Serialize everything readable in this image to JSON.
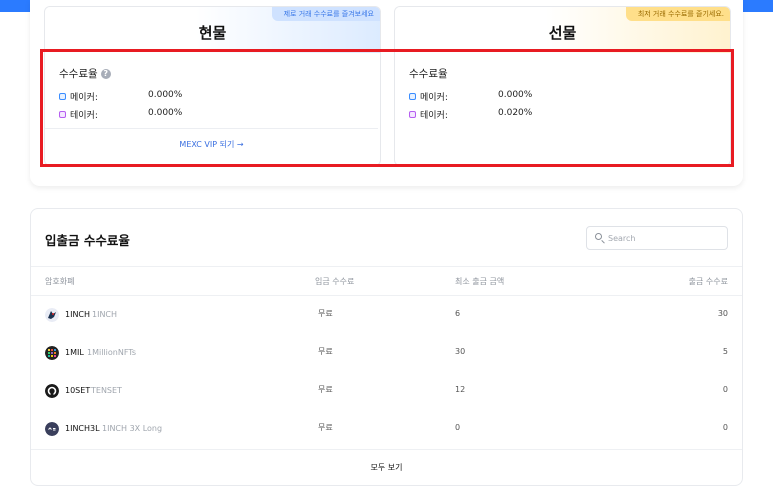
{
  "spot": {
    "title": "현물",
    "promo": "제로 거래 수수료를 즐겨보세요",
    "rate_label": "수수료율",
    "maker_label": "메이커:",
    "maker_value": "0.000%",
    "taker_label": "테이커:",
    "taker_value": "0.000%",
    "vip_link": "MEXC VIP 되기  →"
  },
  "futures": {
    "title": "선물",
    "promo": "최저 거래 수수료를 즐기세요.",
    "rate_label": "수수료율",
    "maker_label": "메이커:",
    "maker_value": "0.000%",
    "taker_label": "테이커:",
    "taker_value": "0.020%"
  },
  "deposit_withdraw": {
    "title": "입출금 수수료율",
    "search_placeholder": "Search",
    "columns": [
      "암호화폐",
      "입금 수수료",
      "최소 출금 금액",
      "출금 수수료"
    ],
    "rows": [
      {
        "symbol": "1INCH",
        "name": "1INCH",
        "deposit_fee": "무료",
        "min_withdraw": "6",
        "withdraw_fee": "30",
        "icon": "1inch-unicorn-icon"
      },
      {
        "symbol": "1MIL",
        "name": "1MillionNFTs",
        "deposit_fee": "무료",
        "min_withdraw": "30",
        "withdraw_fee": "5",
        "icon": "pixel-grid-icon"
      },
      {
        "symbol": "10SET",
        "name": "TENSET",
        "deposit_fee": "무료",
        "min_withdraw": "12",
        "withdraw_fee": "0",
        "icon": "tenset-ring-icon"
      },
      {
        "symbol": "1INCH3L",
        "name": "1INCH 3X Long",
        "deposit_fee": "무료",
        "min_withdraw": "0",
        "withdraw_fee": "0",
        "icon": "leveraged-token-icon"
      }
    ],
    "see_all": "모두 보기"
  },
  "colors": {
    "accent": "#2b7bff",
    "highlight": "#e81b22",
    "link": "#3a6fe0"
  }
}
